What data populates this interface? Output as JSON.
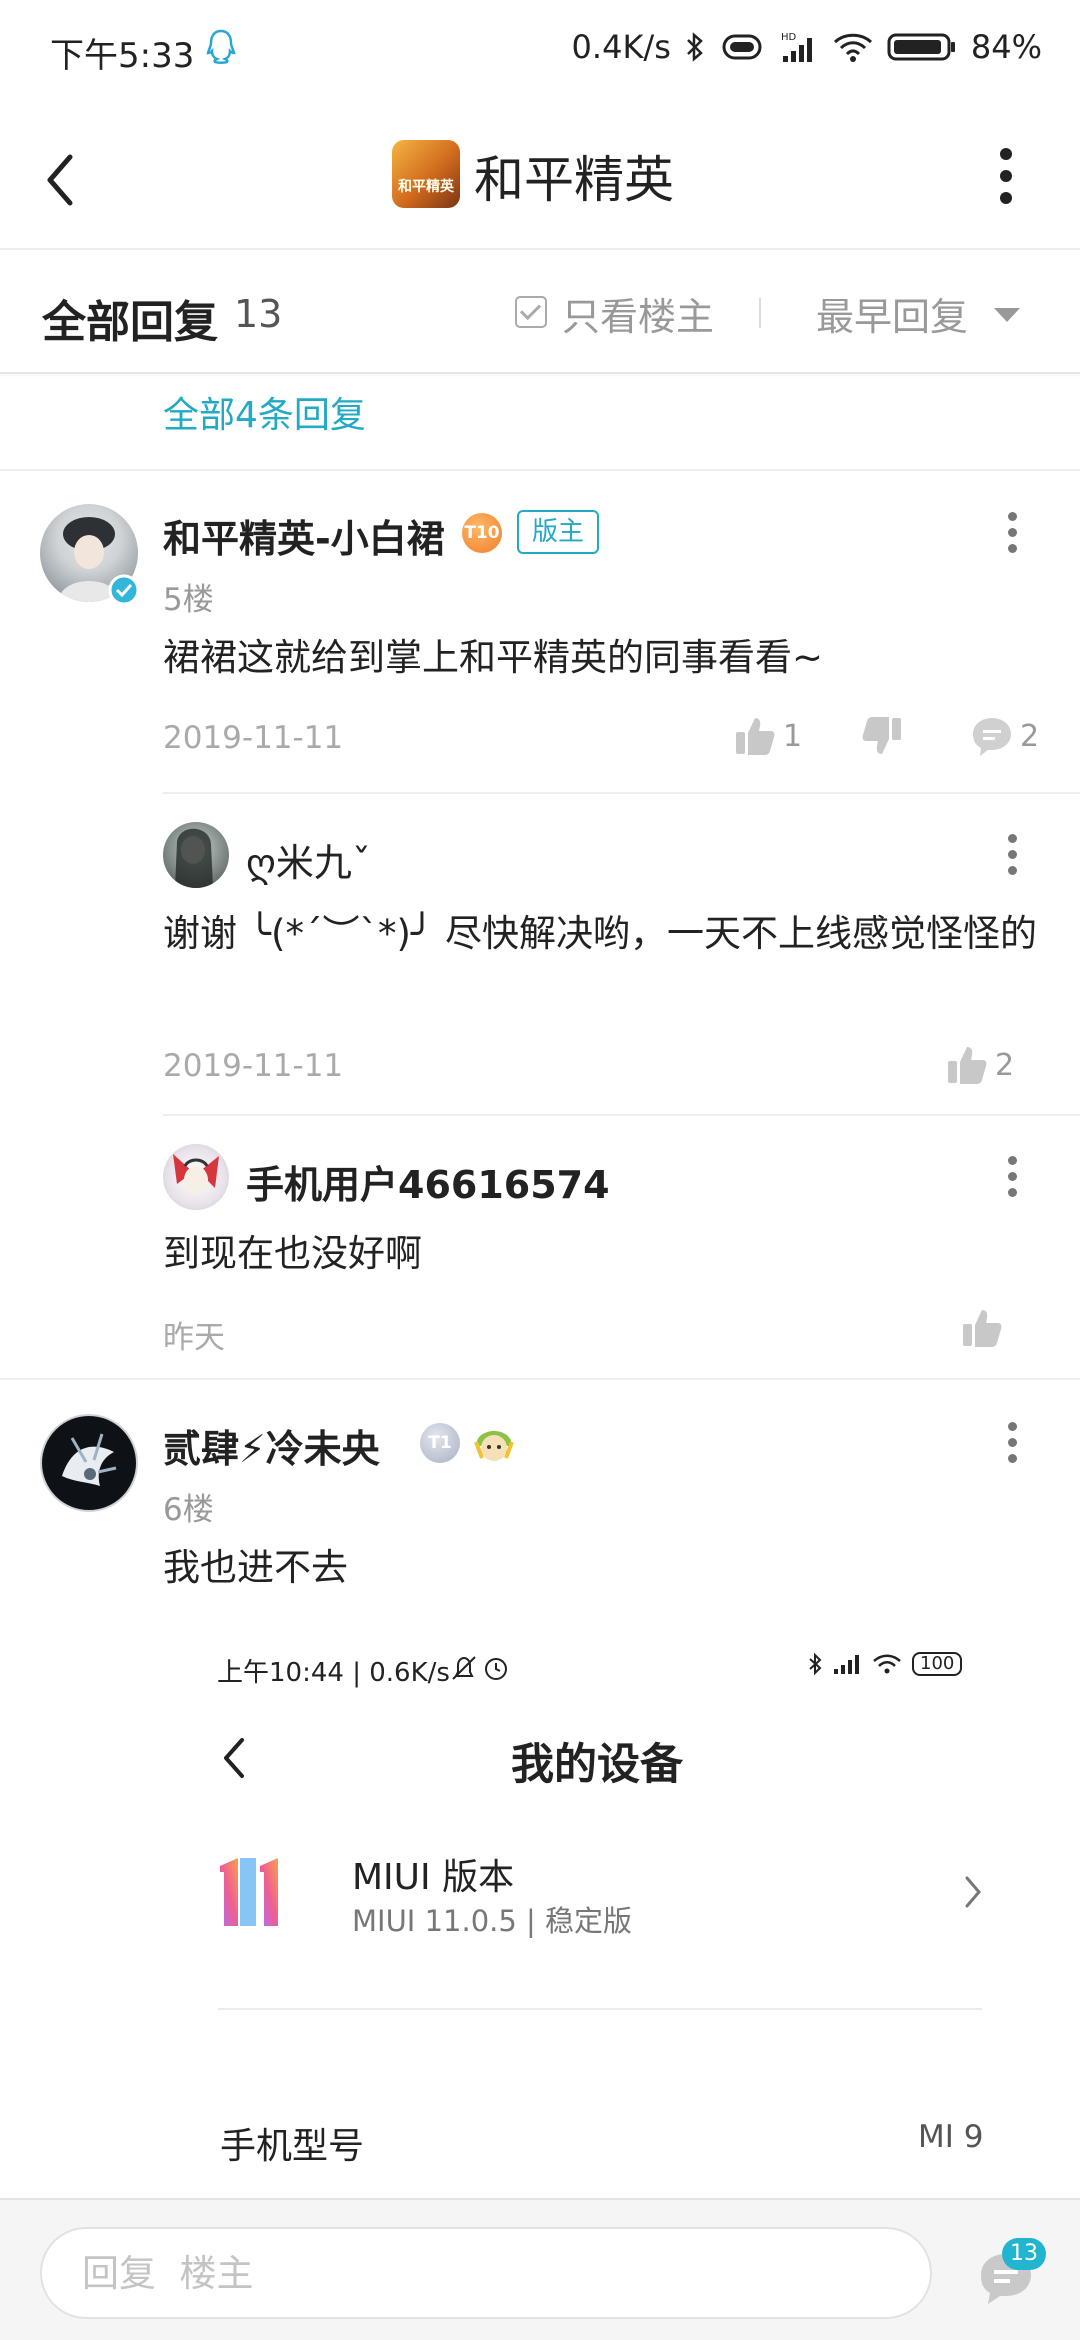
{
  "status_bar": {
    "time": "下午5:33",
    "speed": "0.4K/s",
    "battery": "84%"
  },
  "nav": {
    "title": "和平精英",
    "game_icon_text": "和平精英"
  },
  "sort_bar": {
    "all_replies_label": "全部回复",
    "count": "13",
    "only_op_label": "只看楼主",
    "sort_label": "最早回复"
  },
  "prev_post": {
    "all_replies_link": "全部4条回复"
  },
  "posts": [
    {
      "author": "和平精英-小白裙",
      "level_badge": "T10",
      "role_badge": "版主",
      "floor": "5楼",
      "content": "裙裙这就给到掌上和平精英的同事看看~",
      "date": "2019-11-11",
      "likes": "1",
      "comments": "2",
      "replies": [
        {
          "author": "ღ米九ˇ",
          "content": "谢谢 ╰(*´︶`*)╯ 尽快解决哟，一天不上线感觉怪怪的",
          "date": "2019-11-11",
          "likes": "2"
        },
        {
          "author": "手机用户46616574",
          "content": "到现在也没好啊",
          "date": "昨天",
          "likes": ""
        }
      ]
    },
    {
      "author": "贰肆⚡冷未央",
      "level_badge": "T1",
      "floor": "6楼",
      "content": "我也进不去"
    }
  ],
  "embedded_screenshot": {
    "status_time": "上午10:44 | 0.6K/s",
    "battery": "100",
    "title": "我的设备",
    "miui_name": "MIUI 版本",
    "miui_version": "MIUI 11.0.5 | 稳定版",
    "model_label": "手机型号",
    "model_value": "MI 9"
  },
  "bottom_bar": {
    "reply_placeholder": "回复  楼主",
    "comment_count": "13"
  },
  "colors": {
    "accent": "#22a9c4",
    "text": "#222222",
    "secondary": "#999999"
  }
}
